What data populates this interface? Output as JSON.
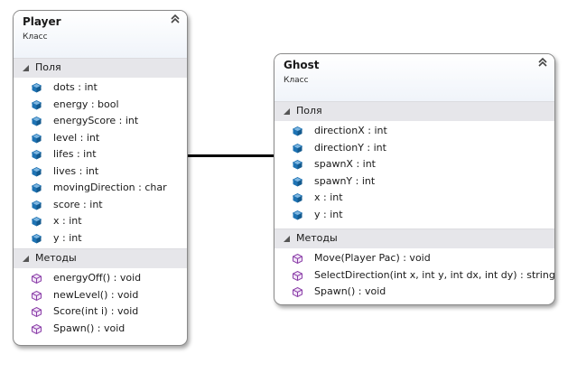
{
  "classes": {
    "player": {
      "name": "Player",
      "stereotype": "Класс",
      "fields_label": "Поля",
      "fields": [
        "dots : int",
        "energy : bool",
        "energyScore : int",
        "level : int",
        "lifes : int",
        "lives : int",
        "movingDirection : char",
        "score : int",
        "x : int",
        "y : int"
      ],
      "methods_label": "Методы",
      "methods": [
        "energyOff() : void",
        "newLevel() : void",
        "Score(int i) : void",
        "Spawn() : void"
      ]
    },
    "ghost": {
      "name": "Ghost",
      "stereotype": "Класс",
      "fields_label": "Поля",
      "fields": [
        "directionX : int",
        "directionY : int",
        "spawnX : int",
        "spawnY : int",
        "x : int",
        "y : int"
      ],
      "methods_label": "Методы",
      "methods": [
        "Move(Player Pac) : void",
        "SelectDirection(int x, int y, int dx, int dy) : string",
        "Spawn() : void"
      ]
    }
  },
  "icons": {
    "field": "field-icon",
    "method": "method-icon",
    "collapse": "double-chevron-up-icon",
    "section_toggle": "triangle-down-icon"
  },
  "colors": {
    "field_icon": "#1e73b4",
    "method_icon": "#8b3fa8",
    "section_bg": "#e6e6ea",
    "connector": "#000000"
  }
}
